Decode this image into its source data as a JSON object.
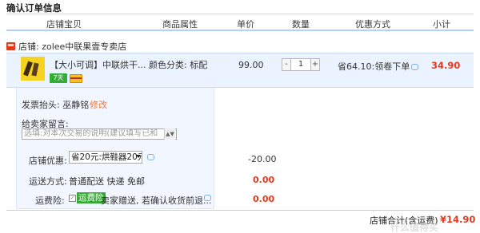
{
  "page": {
    "title": "确认订单信息"
  },
  "columns": {
    "baobei": "店铺宝贝",
    "shuxing": "商品属性",
    "danjia": "单价",
    "shuliang": "数量",
    "youhui": "优惠方式",
    "xiaoji": "小计"
  },
  "shop": {
    "label": "店铺: zolee中联果壹专卖店"
  },
  "item": {
    "title": "【大小可调】中联烘干...  颜色分类: 标配",
    "badge": "7天",
    "price": "99.00",
    "quantity": "1",
    "minus": "-",
    "plus": "+",
    "promo": "省64.10:领卷下单",
    "subtotal": "34.90"
  },
  "invoice": {
    "label": "发票抬头: 巫静铭",
    "edit": "修改"
  },
  "note": {
    "label": "给卖家留言:",
    "placeholder": "选填:对本次交易的说明(建议填写已和",
    "scroll": "▲▼"
  },
  "shop_promo": {
    "label": "店铺优惠:",
    "selected": "省20元:烘鞋器20元",
    "amount": "-20.00"
  },
  "shipping": {
    "label": "运送方式:",
    "value": "普通配送 快递 免邮",
    "amount": "0.00"
  },
  "insurance": {
    "label": "运费险:",
    "tag": "运费险",
    "text": "卖家赠送, 若确认收货前退...",
    "amount": "0.00"
  },
  "total": {
    "label": "店铺合计(含运费)",
    "amount": "¥14.90"
  },
  "watermark": "什么值得买"
}
